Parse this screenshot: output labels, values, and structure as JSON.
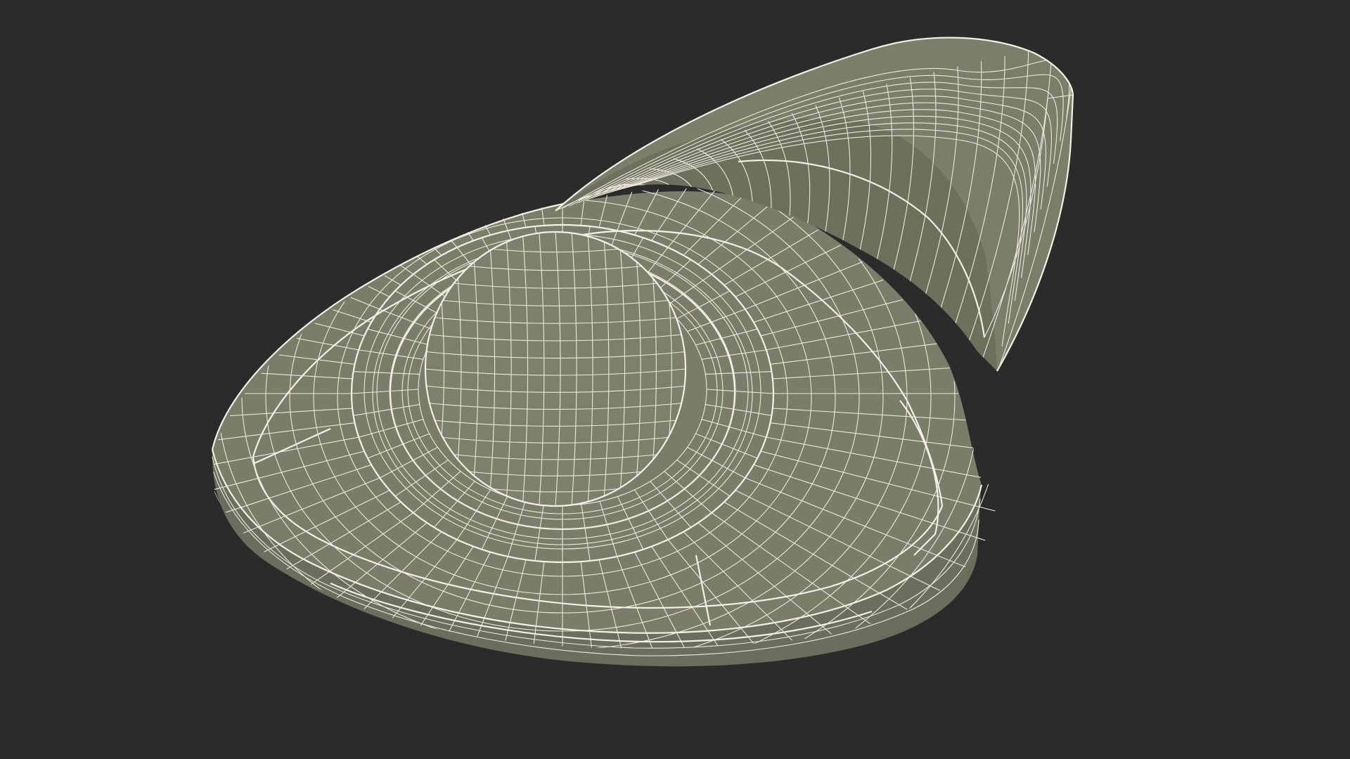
{
  "scene": {
    "subject": "trackball-mouse-3d-model",
    "display_mode": "wireframe-on-shaded"
  },
  "colors": {
    "background": "#2b2b2b",
    "surface": "#7b7d6b",
    "surface_dark": "#6a6c5b",
    "surface_light": "#8a8c79",
    "wire": "#eceadc"
  }
}
